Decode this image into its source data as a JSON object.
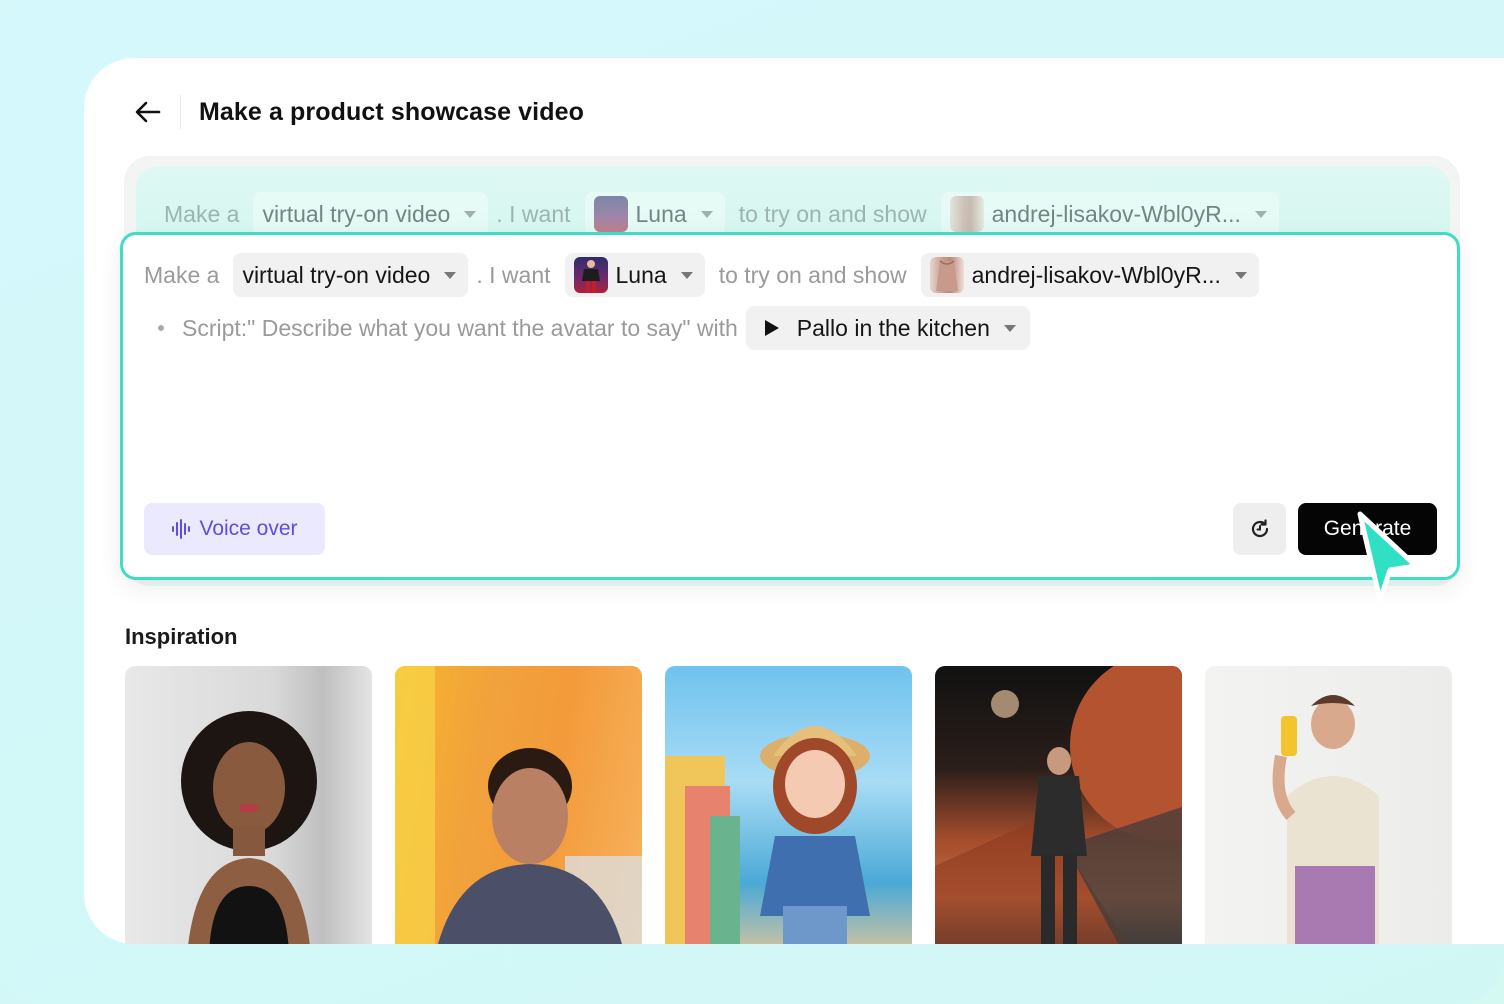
{
  "header": {
    "title": "Make a product showcase video"
  },
  "prompt": {
    "make_a": "Make a",
    "video_type": "virtual try-on video",
    "i_want": ". I want",
    "avatar_name": "Luna",
    "try_on": "to try on and show",
    "product_name": "andrej-lisakov-Wbl0yR...",
    "ghost_product_name": "andrej-lisakov-Wbl0yR...",
    "script_text": "Script:\" Describe what you want the avatar to say\" with",
    "voice_name": "Pallo in the kitchen"
  },
  "actions": {
    "voice_over": "Voice over",
    "generate": "Generate"
  },
  "inspiration": {
    "title": "Inspiration",
    "tiles": [
      "woman-in-black-top",
      "man-talking-orange-wall",
      "cartoon-girl-seaside",
      "man-runway-mars",
      "man-holding-product"
    ]
  },
  "colors": {
    "accent_teal": "#3fdcc8",
    "voice_purple": "#5b4ee0",
    "generate_black": "#050505"
  }
}
